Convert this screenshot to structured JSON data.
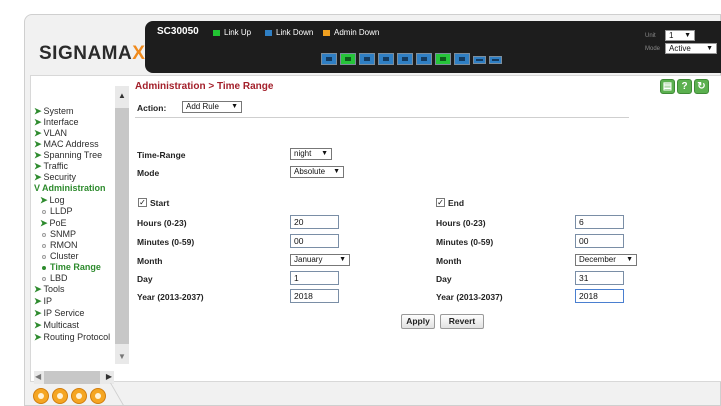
{
  "brand": {
    "logo_main": "SIGNAMA",
    "logo_accent": "X"
  },
  "device": {
    "name": "SC30050",
    "legend": [
      {
        "label": "Link Up",
        "color": "#22c433"
      },
      {
        "label": "Link Down",
        "color": "#2f7fc4"
      },
      {
        "label": "Admin Down",
        "color": "#f0a020"
      }
    ],
    "unit_label": "Unit",
    "unit_value": "1",
    "mode_label": "Mode",
    "mode_value": "Active"
  },
  "sidebar": {
    "items": [
      {
        "label": "System",
        "type": "arrow"
      },
      {
        "label": "Interface",
        "type": "arrow"
      },
      {
        "label": "VLAN",
        "type": "arrow"
      },
      {
        "label": "MAC Address",
        "type": "arrow"
      },
      {
        "label": "Spanning Tree",
        "type": "arrow"
      },
      {
        "label": "Traffic",
        "type": "arrow"
      },
      {
        "label": "Security",
        "type": "arrow"
      },
      {
        "label": "Administration",
        "type": "open"
      },
      {
        "label": "Log",
        "type": "sub-arrow"
      },
      {
        "label": "LLDP",
        "type": "dot"
      },
      {
        "label": "PoE",
        "type": "sub-arrow"
      },
      {
        "label": "SNMP",
        "type": "dot"
      },
      {
        "label": "RMON",
        "type": "dot"
      },
      {
        "label": "Cluster",
        "type": "dot"
      },
      {
        "label": "Time Range",
        "type": "active"
      },
      {
        "label": "LBD",
        "type": "dot"
      },
      {
        "label": "Tools",
        "type": "arrow"
      },
      {
        "label": "IP",
        "type": "arrow"
      },
      {
        "label": "IP Service",
        "type": "arrow"
      },
      {
        "label": "Multicast",
        "type": "arrow"
      },
      {
        "label": "Routing Protocol",
        "type": "arrow"
      }
    ]
  },
  "page": {
    "breadcrumb": "Administration > Time Range",
    "action_label": "Action:",
    "action_value": "Add Rule",
    "time_range_label": "Time-Range",
    "time_range_value": "night",
    "mode_label": "Mode",
    "mode_value": "Absolute"
  },
  "start": {
    "label": "Start",
    "hours_label": "Hours (0-23)",
    "hours": "20",
    "minutes_label": "Minutes (0-59)",
    "minutes": "00",
    "month_label": "Month",
    "month": "January",
    "day_label": "Day",
    "day": "1",
    "year_label": "Year (2013-2037)",
    "year": "2018"
  },
  "end": {
    "label": "End",
    "hours_label": "Hours (0-23)",
    "hours": "6",
    "minutes_label": "Minutes (0-59)",
    "minutes": "00",
    "month_label": "Month",
    "month": "December",
    "day_label": "Day",
    "day": "31",
    "year_label": "Year (2013-2037)",
    "year": "2018"
  },
  "buttons": {
    "apply": "Apply",
    "revert": "Revert"
  },
  "icons": {
    "top_right": [
      "save-icon",
      "help-icon",
      "refresh-icon"
    ],
    "bottom": [
      "home-icon",
      "info-icon",
      "chat-icon",
      "logout-icon"
    ]
  },
  "colors": {
    "accent_green": "#2e8b2e",
    "title_red": "#a31f2a",
    "logo_orange": "#f08a1c"
  }
}
